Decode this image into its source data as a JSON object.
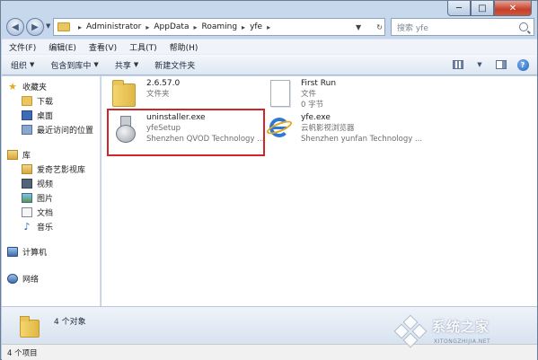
{
  "window": {
    "caption": {
      "min": "─",
      "max": "□",
      "close": "✕"
    }
  },
  "address": {
    "crumbs": [
      "Administrator",
      "AppData",
      "Roaming",
      "yfe"
    ],
    "separator": "▸",
    "search_placeholder": "搜索 yfe"
  },
  "menu": [
    "文件(F)",
    "编辑(E)",
    "查看(V)",
    "工具(T)",
    "帮助(H)"
  ],
  "toolbar": {
    "organize": "组织",
    "include_in_library": "包含到库中",
    "share": "共享",
    "new_folder": "新建文件夹"
  },
  "nav": {
    "favorites": "收藏夹",
    "downloads": "下载",
    "desktop": "桌面",
    "recent": "最近访问的位置",
    "libraries": "库",
    "iqiyi": "爱奇艺影视库",
    "videos": "视频",
    "pictures": "图片",
    "documents": "文档",
    "music": "音乐",
    "computer": "计算机",
    "network": "网络"
  },
  "files": [
    {
      "name": "2.6.57.0",
      "meta1": "文件夹",
      "meta2": ""
    },
    {
      "name": "First Run",
      "meta1": "文件",
      "meta2": "0 字节"
    },
    {
      "name": "uninstaller.exe",
      "meta1": "yfeSetup",
      "meta2": "Shenzhen QVOD Technology ..."
    },
    {
      "name": "yfe.exe",
      "meta1": "云帆影视浏览器",
      "meta2": "Shenzhen yunfan Technology ..."
    }
  ],
  "details": {
    "count": "4 个对象"
  },
  "status": {
    "items": "4 个项目"
  },
  "watermark": {
    "title": "系统之家",
    "sub": "XITONGZHIJIA.NET"
  },
  "colors": {
    "highlight": "#d0262a",
    "frame": "#c7d8ec"
  }
}
